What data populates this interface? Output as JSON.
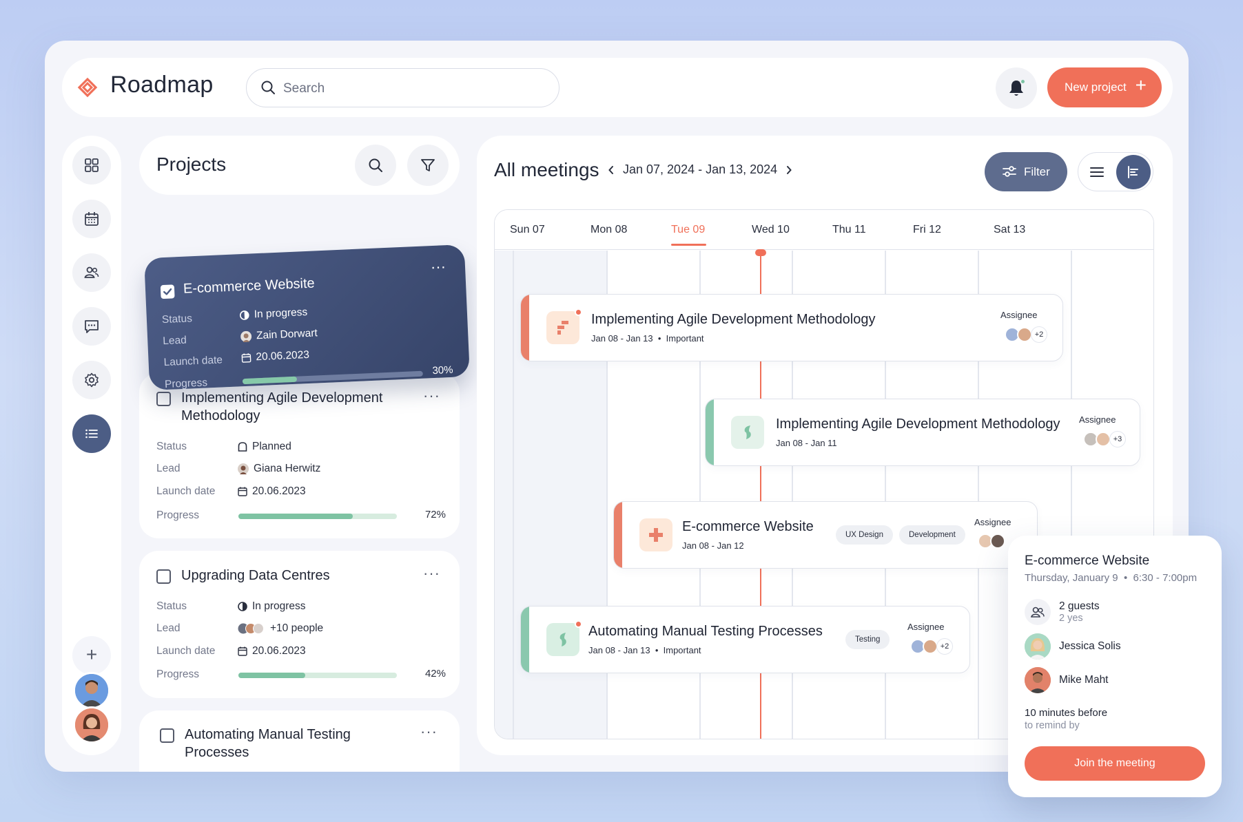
{
  "app": {
    "title": "Roadmap"
  },
  "header": {
    "search_placeholder": "Search",
    "new_project_label": "New project"
  },
  "projects": {
    "title": "Projects",
    "cards": [
      {
        "title": "E-commerce Website",
        "checked": true,
        "status_label": "Status",
        "status": "In progress",
        "lead_label": "Lead",
        "lead": "Zain Dorwart",
        "launch_label": "Launch date",
        "launch": "20.06.2023",
        "progress_label": "Progress",
        "progress": 30,
        "progress_text": "30%"
      },
      {
        "title": "Implementing Agile Development Methodology",
        "checked": false,
        "status_label": "Status",
        "status": "Planned",
        "lead_label": "Lead",
        "lead": "Giana Herwitz",
        "launch_label": "Launch date",
        "launch": "20.06.2023",
        "progress_label": "Progress",
        "progress": 72,
        "progress_text": "72%"
      },
      {
        "title": "Upgrading Data Centres",
        "checked": false,
        "status_label": "Status",
        "status": "In progress",
        "lead_label": "Lead",
        "lead": "+10 people",
        "launch_label": "Launch date",
        "launch": "20.06.2023",
        "progress_label": "Progress",
        "progress": 42,
        "progress_text": "42%"
      },
      {
        "title": "Automating Manual Testing Processes",
        "checked": false
      }
    ]
  },
  "meetings": {
    "title": "All meetings",
    "range": "Jan 07, 2024 - Jan 13, 2024",
    "filter_label": "Filter",
    "days": [
      "Sun 07",
      "Mon 08",
      "Tue 09",
      "Wed 10",
      "Thu 11",
      "Fri 12",
      "Sat 13"
    ],
    "today": "Tue 09",
    "events": [
      {
        "title": "Implementing Agile Development Methodology",
        "dates": "Jan 08 - Jan 13",
        "priority": "Important",
        "assignee_label": "Assignee",
        "extra": "+2",
        "color": "#e9806a"
      },
      {
        "title": "Implementing Agile Development Methodology",
        "dates": "Jan 08 - Jan 11",
        "assignee_label": "Assignee",
        "extra": "+3",
        "color": "#8ac8ae"
      },
      {
        "title": "E-commerce Website",
        "dates": "Jan 08 - Jan 12",
        "tags": [
          "UX Design",
          "Development"
        ],
        "assignee_label": "Assignee",
        "color": "#e9806a"
      },
      {
        "title": "Automating Manual Testing Processes",
        "dates": "Jan 08 - Jan 13",
        "priority": "Important",
        "tags": [
          "Testing"
        ],
        "assignee_label": "Assignee",
        "extra": "+2",
        "color": "#8ac8ae"
      }
    ]
  },
  "popup": {
    "title": "E-commerce Website",
    "date": "Thursday, January 9",
    "time": "6:30 - 7:00pm",
    "guests": "2 guests",
    "guests_sub": "2 yes",
    "people": [
      "Jessica Solis",
      "Mike Maht"
    ],
    "reminder": "10 minutes before",
    "reminder_sub": "to remind by",
    "join_label": "Join the meeting"
  },
  "colors": {
    "accent": "#f07059",
    "primary": "#4c5d85",
    "green": "#7ec3a3"
  },
  "icons": [
    "dashboard-icon",
    "calendar-icon",
    "users-icon",
    "chat-icon",
    "settings-icon",
    "list-icon",
    "search-icon",
    "filter-icon",
    "bell-icon"
  ]
}
